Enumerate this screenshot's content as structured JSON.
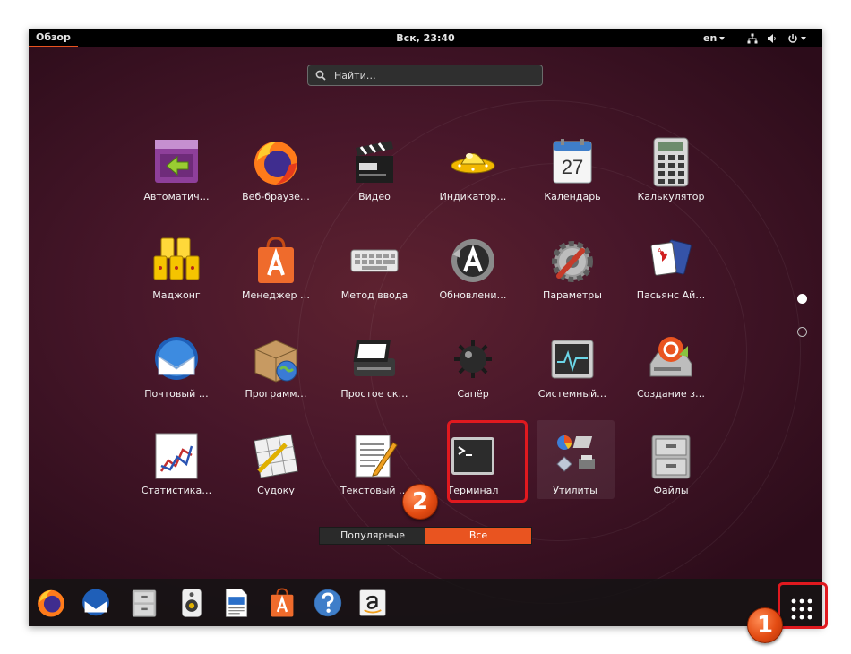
{
  "topbar": {
    "activities_label": "Обзор",
    "clock": "Вск, 23:40",
    "lang": "en"
  },
  "search": {
    "placeholder": "Найти…"
  },
  "apps": [
    {
      "label": "Автоматич…"
    },
    {
      "label": "Веб-браузе…"
    },
    {
      "label": "Видео"
    },
    {
      "label": "Индикатор…"
    },
    {
      "label": "Календарь"
    },
    {
      "label": "Калькулятор"
    },
    {
      "label": "Маджонг"
    },
    {
      "label": "Менеджер …"
    },
    {
      "label": "Метод ввода"
    },
    {
      "label": "Обновлени…"
    },
    {
      "label": "Параметры"
    },
    {
      "label": "Пасьянс Ай…"
    },
    {
      "label": "Почтовый …"
    },
    {
      "label": "Программ…"
    },
    {
      "label": "Простое ск…"
    },
    {
      "label": "Сапёр"
    },
    {
      "label": "Системный…"
    },
    {
      "label": "Создание з…"
    },
    {
      "label": "Статистика…"
    },
    {
      "label": "Судоку"
    },
    {
      "label": "Текстовый …"
    },
    {
      "label": "Терминал"
    },
    {
      "label": "Утилиты"
    },
    {
      "label": "Файлы"
    }
  ],
  "calendar_day": "27",
  "tabs": {
    "popular": "Популярные",
    "all": "Все"
  },
  "markers": {
    "one": "1",
    "two": "2"
  },
  "colors": {
    "accent": "#e95420",
    "highlight": "#e0191f"
  }
}
